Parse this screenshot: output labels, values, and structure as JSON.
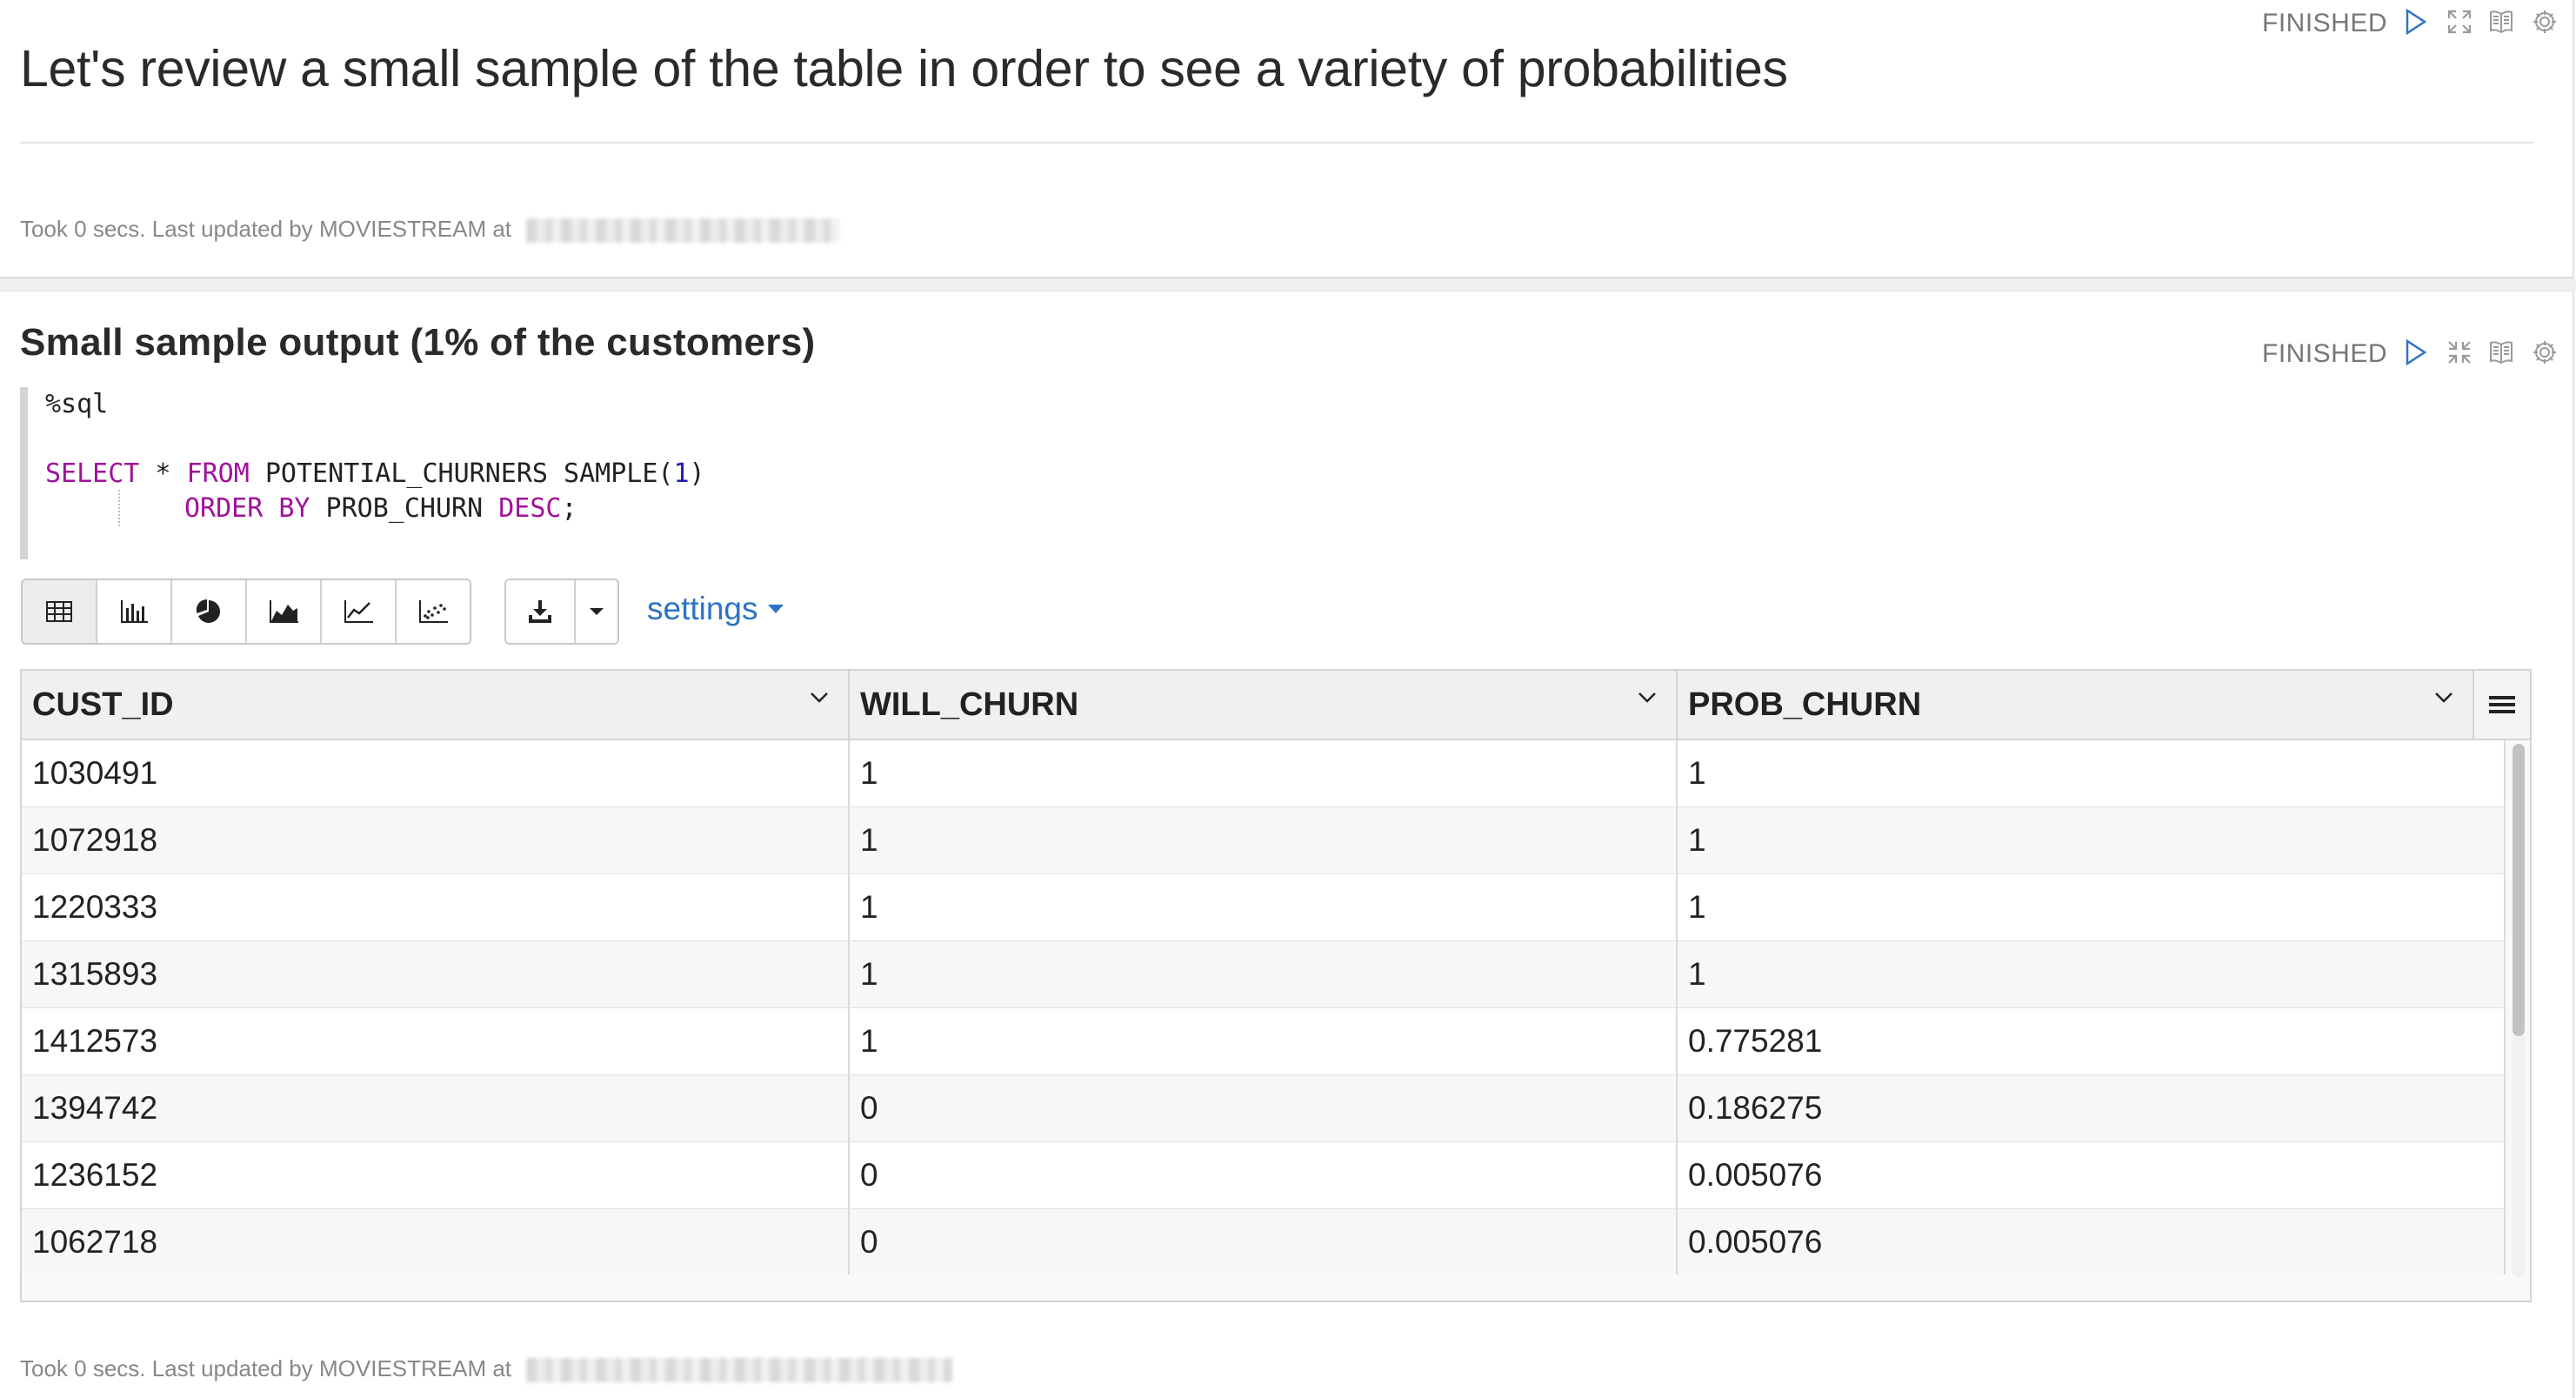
{
  "paragraph1": {
    "status": "FINISHED",
    "title": "Let's review a small sample of the table in order to see a variety of probabilities",
    "footer": "Took 0 secs. Last updated by MOVIESTREAM at"
  },
  "paragraph2": {
    "status": "FINISHED",
    "title": "Small sample output (1% of the customers)",
    "code": {
      "interpreter": "%sql",
      "kw_select": "SELECT",
      "star": " * ",
      "kw_from": "FROM",
      "table_sample": " POTENTIAL_CHURNERS SAMPLE(",
      "sample_num": "1",
      "close_paren": ")",
      "kw_order_by": "ORDER BY",
      "order_col": " PROB_CHURN ",
      "kw_desc": "DESC",
      "semicolon": ";"
    },
    "toolbar": {
      "views": [
        "table-icon",
        "bar-chart-icon",
        "pie-chart-icon",
        "area-chart-icon",
        "line-chart-icon",
        "scatter-chart-icon"
      ],
      "active_view": "table-icon",
      "settings_label": "settings"
    },
    "table": {
      "columns": [
        "CUST_ID",
        "WILL_CHURN",
        "PROB_CHURN"
      ],
      "rows": [
        [
          "1030491",
          "1",
          "1"
        ],
        [
          "1072918",
          "1",
          "1"
        ],
        [
          "1220333",
          "1",
          "1"
        ],
        [
          "1315893",
          "1",
          "1"
        ],
        [
          "1412573",
          "1",
          "0.775281"
        ],
        [
          "1394742",
          "0",
          "0.186275"
        ],
        [
          "1236152",
          "0",
          "0.005076"
        ],
        [
          "1062718",
          "0",
          "0.005076"
        ]
      ]
    },
    "footer": "Took 0 secs. Last updated by MOVIESTREAM at"
  },
  "colors": {
    "keyword": "#a0129a",
    "number": "#1d1ca8",
    "link": "#2c74c6",
    "control_icon": "#2c74c6",
    "status": "#777777"
  }
}
